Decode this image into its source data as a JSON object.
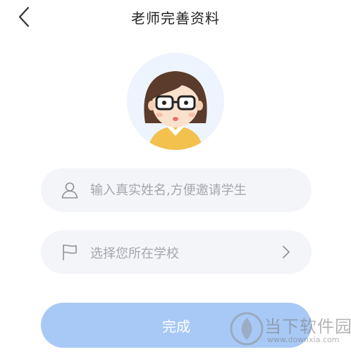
{
  "header": {
    "title": "老师完善资料"
  },
  "form": {
    "name_placeholder": "输入真实姓名,方便邀请学生",
    "school_placeholder": "选择您所在学校",
    "submit_label": "完成"
  },
  "watermark": {
    "text_cn": "当下软件园",
    "text_en": "www.downxia.com"
  },
  "colors": {
    "accent": "#a8c9f5",
    "field_bg": "#f3f5f9",
    "avatar_bg": "#eef4fd"
  }
}
